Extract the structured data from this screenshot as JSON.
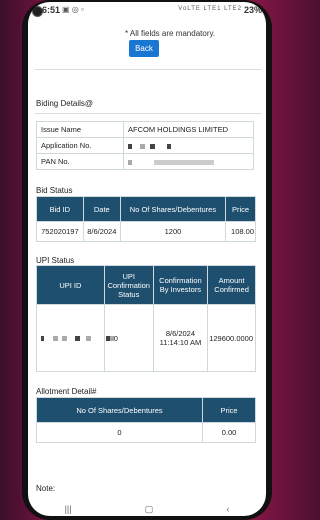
{
  "status_bar": {
    "time": "6:51",
    "battery": "23%",
    "signal_icons": "VoLTE LTE1 LTE2"
  },
  "form": {
    "mandatory_note": "* All fields are mandatory.",
    "back_label": "Back"
  },
  "bid_details": {
    "title": "Biding Details@",
    "rows": [
      {
        "label": "Issue Name",
        "value": "AFCOM HOLDINGS LIMITED"
      },
      {
        "label": "Application No.",
        "value": ""
      },
      {
        "label": "PAN No.",
        "value": ""
      }
    ]
  },
  "bid_status": {
    "title": "Bid Status",
    "headers": [
      "Bid ID",
      "Date",
      "No Of Shares/Debentures",
      "Price"
    ],
    "row": [
      "752020197",
      "8/6/2024",
      "1200",
      "108.00"
    ]
  },
  "upi_status": {
    "title": "UPI Status",
    "headers": [
      "UPI ID",
      "UPI Confirmation Status",
      "Confirmation By Investors",
      "Amount Confirmed"
    ],
    "row": {
      "upi_id": "",
      "status": "0",
      "confirmation": "8/6/2024 11:14:10 AM",
      "amount": "129600.0000"
    }
  },
  "allotment": {
    "title": "Allotment Detail#",
    "headers": [
      "No Of Shares/Debentures",
      "Price"
    ],
    "row": [
      "0",
      "0.00"
    ]
  },
  "note": {
    "label": "Note:"
  },
  "colors": {
    "header_bg": "#1e4f6e",
    "button": "#1976d2",
    "accent_bg": "#c2185b"
  }
}
